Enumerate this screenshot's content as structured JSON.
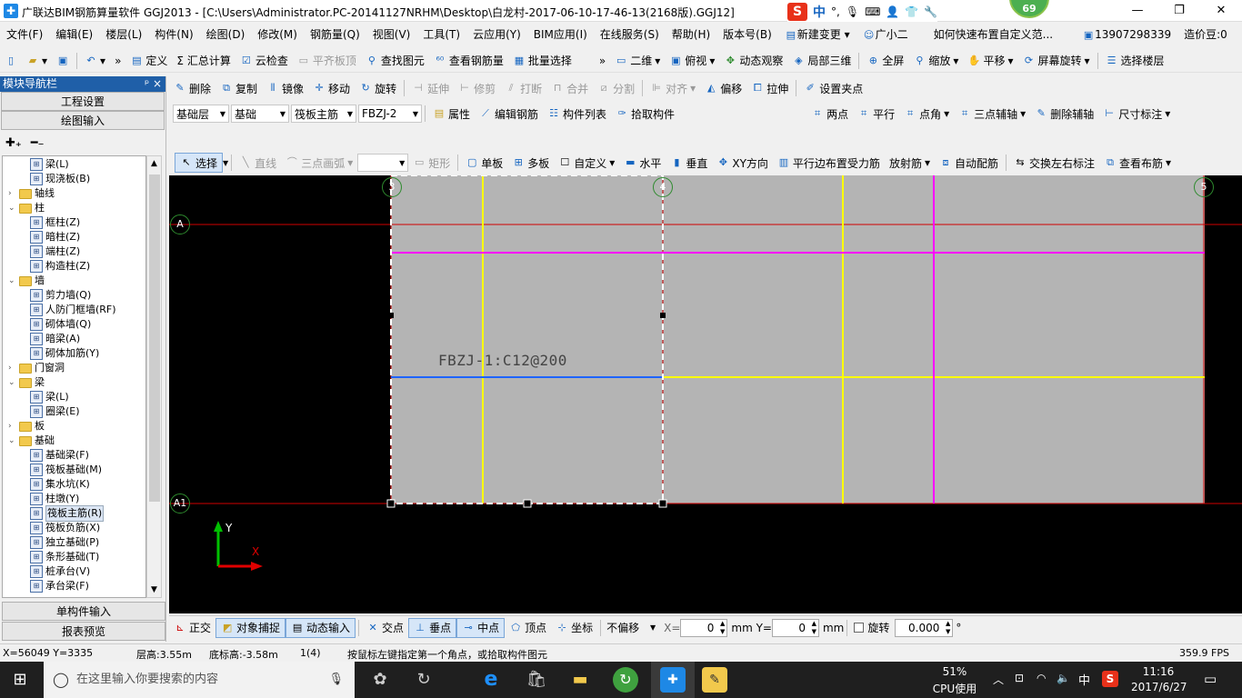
{
  "window": {
    "title": "广联达BIM钢筋算量软件 GGJ2013 - [C:\\Users\\Administrator.PC-20141127NRHM\\Desktop\\白龙村-2017-06-10-17-46-13(2168版).GGJ12]",
    "ime_label": "中",
    "badge": "69"
  },
  "menu": [
    "文件(F)",
    "编辑(E)",
    "楼层(L)",
    "构件(N)",
    "绘图(D)",
    "修改(M)",
    "钢筋量(Q)",
    "视图(V)",
    "工具(T)",
    "云应用(Y)",
    "BIM应用(I)",
    "在线服务(S)",
    "帮助(H)",
    "版本号(B)",
    "新建变更",
    "广小二",
    "如何快速布置自定义范...",
    "13907298339",
    "造价豆:0"
  ],
  "toolbar1": [
    "定义",
    "Σ 汇总计算",
    "云检查",
    "平齐板顶",
    "查找图元",
    "查看钢筋量",
    "批量选择",
    "二维",
    "俯视",
    "动态观察",
    "局部三维",
    "全屏",
    "缩放",
    "平移",
    "屏幕旋转",
    "选择楼层"
  ],
  "toolbar2": [
    "删除",
    "复制",
    "镜像",
    "移动",
    "旋转",
    "延伸",
    "修剪",
    "打断",
    "合并",
    "分割",
    "对齐",
    "偏移",
    "拉伸",
    "设置夹点"
  ],
  "toolbar3": {
    "floor": "基础层",
    "category": "基础",
    "type": "筏板主筋",
    "element": "FBZJ-2",
    "buttons": [
      "属性",
      "编辑钢筋",
      "构件列表",
      "拾取构件"
    ],
    "aux": [
      "两点",
      "平行",
      "点角",
      "三点辅轴",
      "删除辅轴",
      "尺寸标注"
    ]
  },
  "toolbar4": [
    "选择",
    "直线",
    "三点画弧",
    "矩形",
    "单板",
    "多板",
    "自定义",
    "水平",
    "垂直",
    "XY方向",
    "平行边布置受力筋",
    "放射筋",
    "自动配筋",
    "交换左右标注",
    "查看布筋"
  ],
  "left_panel": {
    "header": "模块导航栏",
    "pin": "ᵖ ×",
    "btn_top1": "工程设置",
    "btn_top2": "绘图输入",
    "btn_bottom1": "单构件输入",
    "btn_bottom2": "报表预览",
    "tree": [
      {
        "label": "梁(L)",
        "level": 2,
        "kind": "item"
      },
      {
        "label": "现浇板(B)",
        "level": 2,
        "kind": "item"
      },
      {
        "label": "轴线",
        "level": 1,
        "kind": "folder",
        "exp": "›"
      },
      {
        "label": "柱",
        "level": 1,
        "kind": "folder",
        "exp": "⌄"
      },
      {
        "label": "框柱(Z)",
        "level": 2,
        "kind": "item"
      },
      {
        "label": "暗柱(Z)",
        "level": 2,
        "kind": "item"
      },
      {
        "label": "端柱(Z)",
        "level": 2,
        "kind": "item"
      },
      {
        "label": "构造柱(Z)",
        "level": 2,
        "kind": "item"
      },
      {
        "label": "墙",
        "level": 1,
        "kind": "folder",
        "exp": "⌄"
      },
      {
        "label": "剪力墙(Q)",
        "level": 2,
        "kind": "item"
      },
      {
        "label": "人防门框墙(RF)",
        "level": 2,
        "kind": "item"
      },
      {
        "label": "砌体墙(Q)",
        "level": 2,
        "kind": "item"
      },
      {
        "label": "暗梁(A)",
        "level": 2,
        "kind": "item"
      },
      {
        "label": "砌体加筋(Y)",
        "level": 2,
        "kind": "item"
      },
      {
        "label": "门窗洞",
        "level": 1,
        "kind": "folder",
        "exp": "›"
      },
      {
        "label": "梁",
        "level": 1,
        "kind": "folder",
        "exp": "⌄"
      },
      {
        "label": "梁(L)",
        "level": 2,
        "kind": "item"
      },
      {
        "label": "圈梁(E)",
        "level": 2,
        "kind": "item"
      },
      {
        "label": "板",
        "level": 1,
        "kind": "folder",
        "exp": "›"
      },
      {
        "label": "基础",
        "level": 1,
        "kind": "folder",
        "exp": "⌄"
      },
      {
        "label": "基础梁(F)",
        "level": 2,
        "kind": "item"
      },
      {
        "label": "筏板基础(M)",
        "level": 2,
        "kind": "item"
      },
      {
        "label": "集水坑(K)",
        "level": 2,
        "kind": "item"
      },
      {
        "label": "柱墩(Y)",
        "level": 2,
        "kind": "item"
      },
      {
        "label": "筏板主筋(R)",
        "level": 2,
        "kind": "item",
        "selected": true
      },
      {
        "label": "筏板负筋(X)",
        "level": 2,
        "kind": "item"
      },
      {
        "label": "独立基础(P)",
        "level": 2,
        "kind": "item"
      },
      {
        "label": "条形基础(T)",
        "level": 2,
        "kind": "item"
      },
      {
        "label": "桩承台(V)",
        "level": 2,
        "kind": "item"
      },
      {
        "label": "承台梁(F)",
        "level": 2,
        "kind": "item"
      }
    ]
  },
  "canvas": {
    "axis_labels": [
      "3",
      "4",
      "5",
      "A",
      "A1"
    ],
    "rebar_text": "FBZJ-1:C12@200",
    "ucs_y": "Y",
    "ucs_x": "X"
  },
  "bottom_bar": {
    "items": [
      "正交",
      "对象捕捉",
      "动态输入",
      "交点",
      "垂点",
      "中点",
      "顶点",
      "坐标"
    ],
    "offset": "不偏移",
    "x_label": "X=",
    "x_value": "0",
    "y_label": "mm Y=",
    "y_value": "0",
    "mm": "mm",
    "rotate_label": "旋转",
    "rotate_value": "0.000",
    "deg": "°"
  },
  "status": {
    "coords": "X=56049 Y=3335",
    "floor_height": "层高:3.55m",
    "base_height": "底标高:-3.58m",
    "count": "1(4)",
    "hint": "按鼠标左键指定第一个角点，或拾取构件图元",
    "fps": "359.9 FPS"
  },
  "taskbar": {
    "search_placeholder": "在这里输入你要搜索的内容",
    "cpu_percent": "51%",
    "cpu_label": "CPU使用",
    "ime": "中",
    "time": "11:16",
    "date": "2017/6/27"
  },
  "colors": {
    "grid_red": "#d00000",
    "rebar_yellow": "#ffff00",
    "rebar_magenta": "#ff00ff",
    "rebar_blue": "#1e64ff",
    "slab_gray": "#b4b4b4",
    "axis_green": "#2e8b2e"
  }
}
